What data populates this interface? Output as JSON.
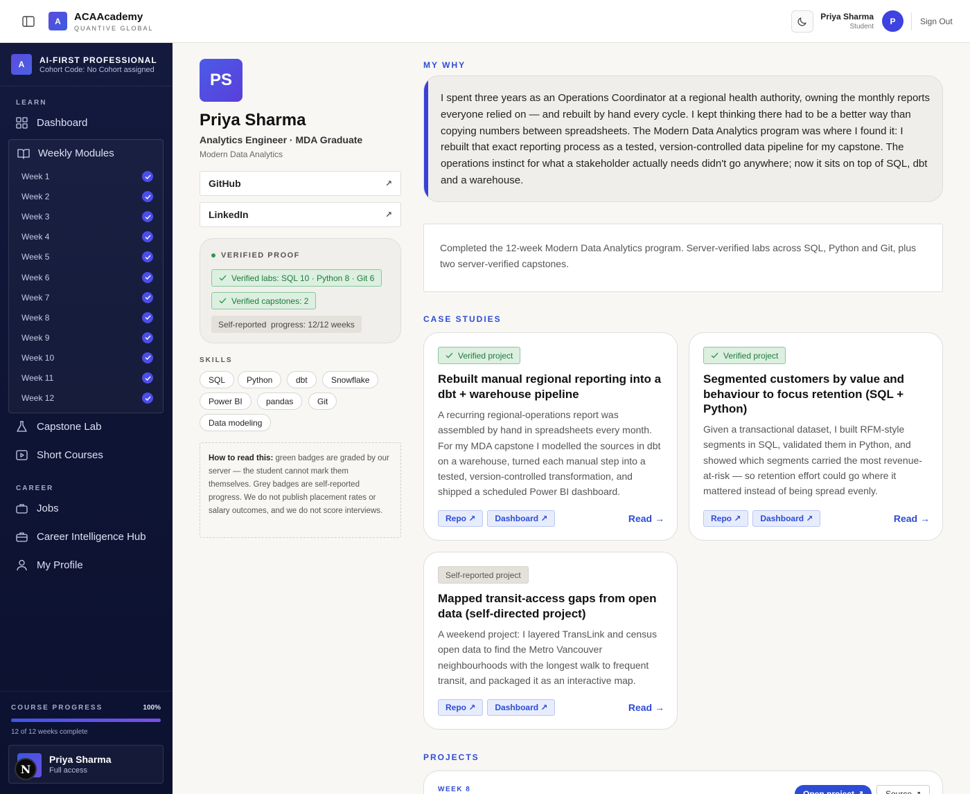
{
  "topbar": {
    "brand_logo_letter": "A",
    "brand_name": "ACAAcademy",
    "brand_sub": "QUANTIVE GLOBAL",
    "user_name": "Priya Sharma",
    "user_role": "Student",
    "avatar_letter": "P",
    "sign_out": "Sign Out"
  },
  "sidebar": {
    "cohort": {
      "logo_letter": "A",
      "title": "AI-FIRST PROFESSIONAL",
      "code": "Cohort Code: No Cohort assigned"
    },
    "learn_label": "LEARN",
    "dashboard": "Dashboard",
    "weekly_modules": "Weekly Modules",
    "weeks": [
      "Week 1",
      "Week 2",
      "Week 3",
      "Week 4",
      "Week 5",
      "Week 6",
      "Week 7",
      "Week 8",
      "Week 9",
      "Week 10",
      "Week 11",
      "Week 12"
    ],
    "capstone_lab": "Capstone Lab",
    "short_courses": "Short Courses",
    "career_label": "CAREER",
    "jobs": "Jobs",
    "career_hub": "Career Intelligence Hub",
    "my_profile": "My Profile",
    "progress": {
      "label": "COURSE PROGRESS",
      "percent_text": "100%",
      "value": 1.0,
      "sub": "12 of 12 weeks complete"
    },
    "user_card": {
      "name": "Priya Sharma",
      "access": "Full access",
      "badge_letter": "N"
    }
  },
  "profile": {
    "initials": "PS",
    "name": "Priya Sharma",
    "title": "Analytics Engineer · MDA Graduate",
    "program": "Modern Data Analytics",
    "links": [
      {
        "label": "GitHub",
        "arrow": "↗"
      },
      {
        "label": "LinkedIn",
        "arrow": "↗"
      }
    ],
    "proof": {
      "title": "VERIFIED PROOF",
      "labs": "Verified labs: SQL 10 · Python 8 · Git 6",
      "capstones": "Verified capstones: 2",
      "self_reported": "Self-reported  progress: 12/12 weeks"
    },
    "skills_label": "SKILLS",
    "skills": [
      "SQL",
      "Python",
      "dbt",
      "Snowflake",
      "Power BI",
      "pandas",
      "Git",
      "Data modeling"
    ],
    "howto_bold": "How to read this:",
    "howto_text": " green badges are graded by our server — the student cannot mark them themselves. Grey badges are self-reported progress. We do not publish placement rates or salary outcomes, and we do not score interviews."
  },
  "main": {
    "why_label": "MY WHY",
    "why_text": "I spent three years as an Operations Coordinator at a regional health authority, owning the monthly reports everyone relied on — and rebuilt by hand every cycle. I kept thinking there had to be a better way than copying numbers between spreadsheets. The Modern Data Analytics program was where I found it: I rebuilt that exact reporting process as a tested, version-controlled data pipeline for my capstone. The operations instinct for what a stakeholder actually needs didn't go anywhere; now it sits on top of SQL, dbt and a warehouse.",
    "summary": "Completed the 12-week Modern Data Analytics program. Server-verified labs across SQL, Python and Git, plus two server-verified capstones.",
    "case_label": "CASE STUDIES",
    "cases": [
      {
        "badge": "Verified project",
        "title": "Rebuilt manual regional reporting into a dbt + warehouse pipeline",
        "desc": "A recurring regional-operations report was assembled by hand in spreadsheets every month. For my MDA capstone I modelled the sources in dbt on a warehouse, turned each manual step into a tested, version-controlled transformation, and shipped a scheduled Power BI dashboard.",
        "repo": "Repo ↗",
        "dashboard": "Dashboard ↗",
        "read": "Read →"
      },
      {
        "badge": "Verified project",
        "title": "Segmented customers by value and behaviour to focus retention (SQL + Python)",
        "desc": "Given a transactional dataset, I built RFM-style segments in SQL, validated them in Python, and showed which segments carried the most revenue-at-risk — so retention effort could go where it mattered instead of being spread evenly.",
        "repo": "Repo ↗",
        "dashboard": "Dashboard ↗",
        "read": "Read →"
      },
      {
        "badge": "Self-reported project",
        "title": "Mapped transit-access gaps from open data (self-directed project)",
        "desc": "A weekend project: I layered TransLink and census open data to find the Metro Vancouver neighbourhoods with the longest walk to frequent transit, and packaged it as an interactive map.",
        "repo": "Repo ↗",
        "dashboard": "Dashboard ↗",
        "read": "Read →"
      }
    ],
    "projects_label": "PROJECTS",
    "project": {
      "week": "WEEK 8",
      "open": "Open project ↗",
      "source": "Source ↗"
    }
  }
}
